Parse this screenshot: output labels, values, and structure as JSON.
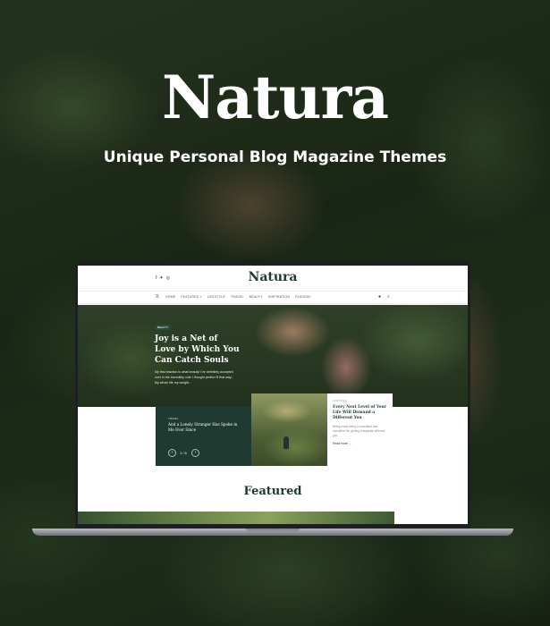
{
  "hero": {
    "title": "Natura",
    "subtitle": "Unique Personal Blog Magazine Themes"
  },
  "site": {
    "logo": "Natura",
    "social_icons": [
      "facebook-icon",
      "twitter-icon",
      "instagram-icon"
    ],
    "nav": {
      "items": [
        "HOME",
        "FEATURES ˅",
        "LIFESTYLE",
        "TRAVEL",
        "BEAUTY",
        "INSPIRATION",
        "FASHION"
      ]
    },
    "main_post": {
      "category": "BEAUTY",
      "title": "Joy is a Net of Love by Which You Can Catch Souls",
      "excerpt": "My first reaction is what beauty! I've definitely accepted over in the incredibly cute I thought perfect B that way... My whole life my weight..."
    },
    "slider": {
      "category": "TRAVEL",
      "title": "And a Lonely Stranger Has Spoke in Me Ever Since",
      "counter": "1 / 5",
      "prev": "‹",
      "next": "›"
    },
    "side_post": {
      "category": "LIFESTYLE",
      "title": "Every Next Level of Your Life Will Demand a Different You",
      "excerpt": "Being proud being a consultant and incredible life, getting a separate different you.",
      "more": "Read more →"
    },
    "featured": "Featured"
  },
  "colors": {
    "brand_green": "#1d3a2e",
    "card_green": "#1f3b31"
  }
}
